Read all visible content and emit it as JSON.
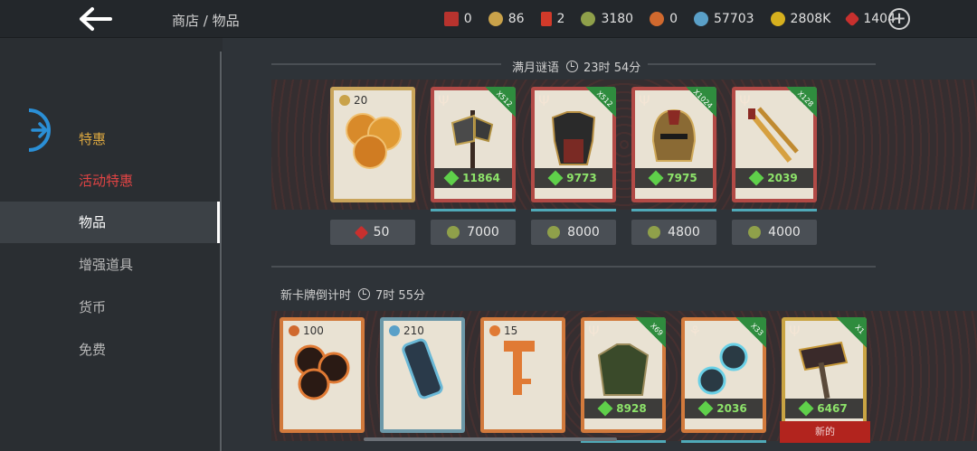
{
  "header": {
    "breadcrumb": "商店 / 物品",
    "resources": [
      {
        "icon": "red-token-icon",
        "color": "#b8332e",
        "value": "0"
      },
      {
        "icon": "gold-emblem-icon",
        "color": "#c9a24a",
        "value": "86"
      },
      {
        "icon": "red-card-icon",
        "color": "#d23a2a",
        "value": "2"
      },
      {
        "icon": "green-coin-icon",
        "color": "#8fa04a",
        "value": "3180"
      },
      {
        "icon": "orange-coin-icon",
        "color": "#d0692e",
        "value": "0"
      },
      {
        "icon": "blue-spiral-icon",
        "color": "#5aa0c8",
        "value": "57703"
      },
      {
        "icon": "gold-coin-icon",
        "color": "#d6b01e",
        "value": "2808K"
      },
      {
        "icon": "red-gem-icon",
        "color": "#c8302e",
        "value": "1404"
      }
    ]
  },
  "sidebar": {
    "items": [
      {
        "label": "特惠",
        "color": "#d9a640"
      },
      {
        "label": "活动特惠",
        "color": "#e04444"
      },
      {
        "label": "物品",
        "color": "#ffffff"
      },
      {
        "label": "增强道具",
        "color": "#b8b8b8"
      },
      {
        "label": "货币",
        "color": "#b8b8b8"
      },
      {
        "label": "免费",
        "color": "#b8b8b8"
      }
    ]
  },
  "section1": {
    "title": "满月谜语",
    "timer": "23时 54分",
    "cards": [
      {
        "count": "20",
        "price": "50"
      },
      {
        "multiplier": "X512",
        "power": "11864",
        "price": "7000"
      },
      {
        "multiplier": "X512",
        "power": "9773",
        "price": "8000"
      },
      {
        "multiplier": "X1024",
        "power": "7975",
        "price": "4800"
      },
      {
        "multiplier": "X128",
        "power": "2039",
        "price": "4000"
      }
    ]
  },
  "section2": {
    "title": "新卡牌倒计时",
    "timer": "7时 55分",
    "cards": [
      {
        "count": "100"
      },
      {
        "count": "210"
      },
      {
        "count": "15"
      },
      {
        "multiplier": "X69",
        "power": "8928"
      },
      {
        "multiplier": "X33",
        "power": "2036"
      },
      {
        "multiplier": "X1",
        "power": "6467"
      }
    ],
    "new_badge": "新的"
  }
}
